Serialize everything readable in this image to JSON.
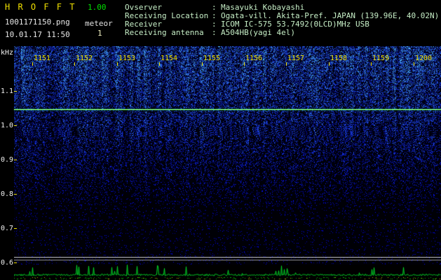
{
  "header": {
    "title": "H R O F F T",
    "version": "1.00",
    "filename": "1001171150.png",
    "mode_label": "meteor",
    "meteor_count": "1",
    "datetime": "10.01.17 11:50",
    "separator": ":",
    "info": [
      {
        "label": "Ovserver",
        "value": "Masayuki Kobayashi"
      },
      {
        "label": "Receiving Location",
        "value": "Ogata-vill. Akita-Pref. JAPAN (139.96E, 40.02N)"
      },
      {
        "label": "Receiver",
        "value": "ICOM IC-575 53.7492(0LCD)MHz USB"
      },
      {
        "label": "Receiving antenna",
        "value": "A504HB(yagi 4el)"
      }
    ]
  },
  "spectrogram": {
    "y_axis_unit": "kHz",
    "y_tick_labels": [
      "1.1",
      "1.0",
      "0.9",
      "0.8",
      "0.7",
      "0.6"
    ],
    "time_tick_labels": [
      "1151",
      "1152",
      "1153",
      "1154",
      "1155",
      "1156",
      "1157",
      "1158",
      "1159",
      "1200"
    ],
    "carrier_line_frequency_khz": 1.04
  },
  "colors": {
    "title_yellow": "#f0e000",
    "version_green": "#00e000",
    "info_text_green": "#c6eec6",
    "time_label_yellow": "#f0e000",
    "axis_label_white": "#f2f2f2",
    "carrier_line_green": "#8cff7a",
    "interference_line_gray": "#bcbcbc",
    "level_trace_green": "#00dc28",
    "noise_speckle_blue": "#2040ff",
    "background_black": "#000000"
  }
}
